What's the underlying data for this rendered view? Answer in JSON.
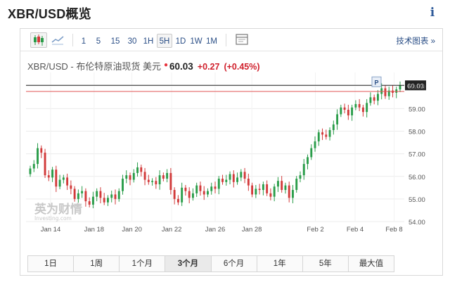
{
  "page": {
    "title": "XBR/USD概览",
    "info_icon": "info-icon"
  },
  "toolbar": {
    "chart_type_icons": [
      "candlestick-icon",
      "line-chart-icon"
    ],
    "intervals": [
      "1",
      "5",
      "15",
      "30",
      "1H",
      "5H",
      "1D",
      "1W",
      "1M"
    ],
    "active_interval": "5H",
    "settings_icon": "chart-settings-icon",
    "tech_chart_label": "技术图表 »"
  },
  "quote": {
    "name": "XBR/USD - 布伦特原油现货 美元",
    "marker": "●",
    "price": "60.03",
    "change": "+0.27",
    "change_pct": "(+0.45%)",
    "up_color": "#d0202c"
  },
  "chart_data": {
    "type": "candlestick",
    "title": "",
    "x_tick_labels": [
      "Jan 14",
      "Jan 18",
      "Jan 20",
      "Jan 22",
      "Jan 26",
      "Jan 28",
      "Feb 2",
      "Feb 4",
      "Feb 8"
    ],
    "y_tick_labels": [
      "60.00",
      "59.00",
      "58.00",
      "57.00",
      "56.00",
      "55.00",
      "54.00"
    ],
    "ylim": [
      54.0,
      60.6
    ],
    "last_price_label": "60.03",
    "last_price_line": 60.03,
    "prev_close_line": 59.76,
    "marker_label": "P",
    "watermark": {
      "main": "英为财情",
      "sub": "Investing.com"
    },
    "up_color": "#2a9d4a",
    "down_color": "#d23a3a",
    "closes": [
      56.35,
      56.55,
      57.25,
      57.05,
      56.05,
      55.95,
      56.3,
      55.55,
      55.85,
      55.95,
      55.6,
      55.45,
      55.0,
      55.25,
      55.35,
      54.9,
      54.75,
      55.1,
      55.35,
      55.05,
      54.85,
      55.05,
      55.2,
      55.0,
      55.35,
      55.9,
      56.05,
      55.85,
      56.15,
      56.4,
      56.2,
      55.85,
      55.75,
      55.8,
      55.65,
      56.05,
      55.9,
      56.15,
      55.4,
      55.0,
      54.85,
      55.5,
      55.35,
      55.05,
      55.25,
      55.6,
      55.35,
      55.2,
      55.35,
      55.55,
      55.45,
      55.9,
      55.75,
      55.85,
      56.1,
      55.75,
      55.95,
      56.2,
      55.9,
      55.6,
      55.2,
      55.45,
      55.4,
      55.65,
      55.25,
      55.1,
      55.55,
      55.8,
      55.4,
      55.6,
      55.05,
      55.4,
      55.9,
      56.05,
      56.55,
      56.85,
      57.25,
      57.55,
      57.95,
      57.85,
      57.75,
      58.05,
      58.3,
      58.75,
      59.05,
      58.95,
      58.7,
      59.05,
      59.2,
      59.05,
      58.85,
      59.25,
      59.5,
      59.35,
      59.65,
      59.9,
      59.55,
      59.8,
      59.7,
      59.85,
      60.03
    ],
    "opens": [
      56.1,
      56.35,
      56.55,
      57.25,
      57.05,
      56.05,
      55.95,
      56.3,
      55.55,
      55.85,
      55.95,
      55.6,
      55.45,
      55.0,
      55.25,
      55.35,
      54.9,
      54.75,
      55.1,
      55.35,
      55.05,
      54.85,
      55.05,
      55.2,
      55.0,
      55.35,
      55.9,
      56.05,
      55.85,
      56.15,
      56.4,
      56.2,
      55.85,
      55.75,
      55.8,
      55.65,
      56.05,
      55.9,
      56.15,
      55.4,
      55.0,
      54.85,
      55.5,
      55.35,
      55.05,
      55.25,
      55.6,
      55.35,
      55.2,
      55.35,
      55.55,
      55.45,
      55.9,
      55.75,
      55.85,
      56.1,
      55.75,
      55.95,
      56.2,
      55.9,
      55.6,
      55.2,
      55.45,
      55.4,
      55.65,
      55.25,
      55.1,
      55.55,
      55.8,
      55.4,
      55.6,
      55.05,
      55.4,
      55.9,
      56.05,
      56.55,
      56.85,
      57.25,
      57.55,
      57.95,
      57.85,
      57.75,
      58.05,
      58.3,
      58.75,
      59.05,
      58.95,
      58.7,
      59.05,
      59.2,
      59.05,
      58.85,
      59.25,
      59.5,
      59.35,
      59.65,
      59.9,
      59.55,
      59.8,
      59.7,
      59.85
    ]
  },
  "ranges": {
    "items": [
      "1日",
      "1周",
      "1个月",
      "3个月",
      "6个月",
      "1年",
      "5年",
      "最大值"
    ],
    "active": "3个月"
  }
}
